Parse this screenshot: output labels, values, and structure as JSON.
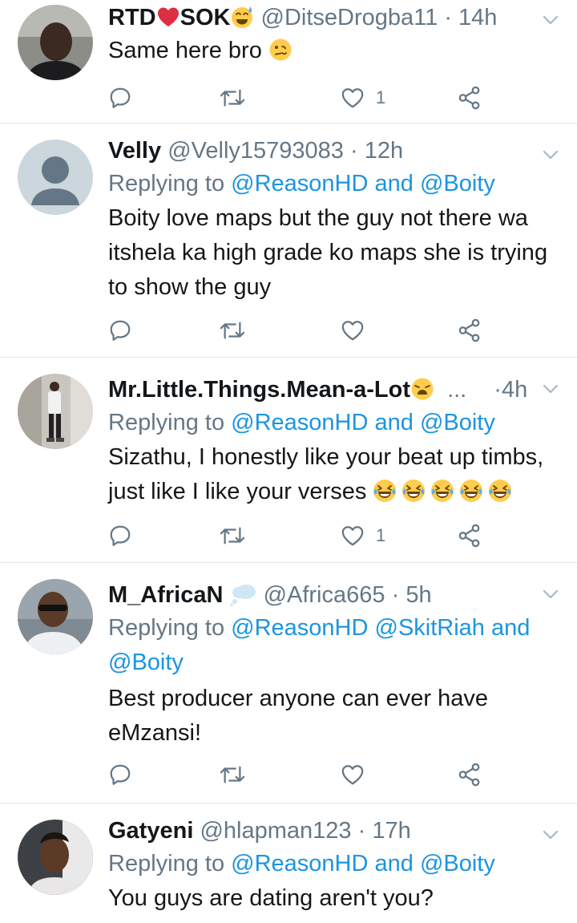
{
  "tweets": [
    {
      "name": "RTD",
      "name2": "SOK",
      "handle": "@DitseDrogba11",
      "time": "14h",
      "replying": null,
      "text": "Same here bro",
      "likes": "1"
    },
    {
      "name": "Velly",
      "handle": "@Velly15793083",
      "time": "12h",
      "replying": {
        "prefix": "Replying to",
        "m1": "@ReasonHD",
        "and": "and",
        "m2": "@Boity"
      },
      "text": "Boity love maps but the guy not there wa itshela ka high grade ko maps she is trying to show the guy",
      "likes": ""
    },
    {
      "name": "Mr.Little.Things.Mean-a-Lot",
      "ellipsis": "...",
      "time": "4h",
      "replying": {
        "prefix": "Replying to",
        "m1": "@ReasonHD",
        "and": "and",
        "m2": "@Boity"
      },
      "text_line1": "Sizathu, I honestly like your beat up timbs,",
      "text_line2": "just like I like your verses",
      "likes": "1"
    },
    {
      "name": "M_AfricaN",
      "handle": "@Africa665",
      "time": "5h",
      "replying": {
        "prefix": "Replying to",
        "m1": "@ReasonHD",
        "m2": "@SkitRiah",
        "and": "and",
        "m3": "@Boity"
      },
      "text": "Best producer anyone can ever have eMzansi!",
      "likes": ""
    },
    {
      "name": "Gatyeni",
      "handle": "@hlapman123",
      "time": "17h",
      "replying": {
        "prefix": "Replying to",
        "m1": "@ReasonHD",
        "and": "and",
        "m2": "@Boity"
      },
      "text": "You guys are dating aren't you?"
    }
  ],
  "dot": "·",
  "icons": [
    "reply-icon",
    "retweet-icon",
    "like-icon",
    "share-icon",
    "chevron-down-icon"
  ]
}
